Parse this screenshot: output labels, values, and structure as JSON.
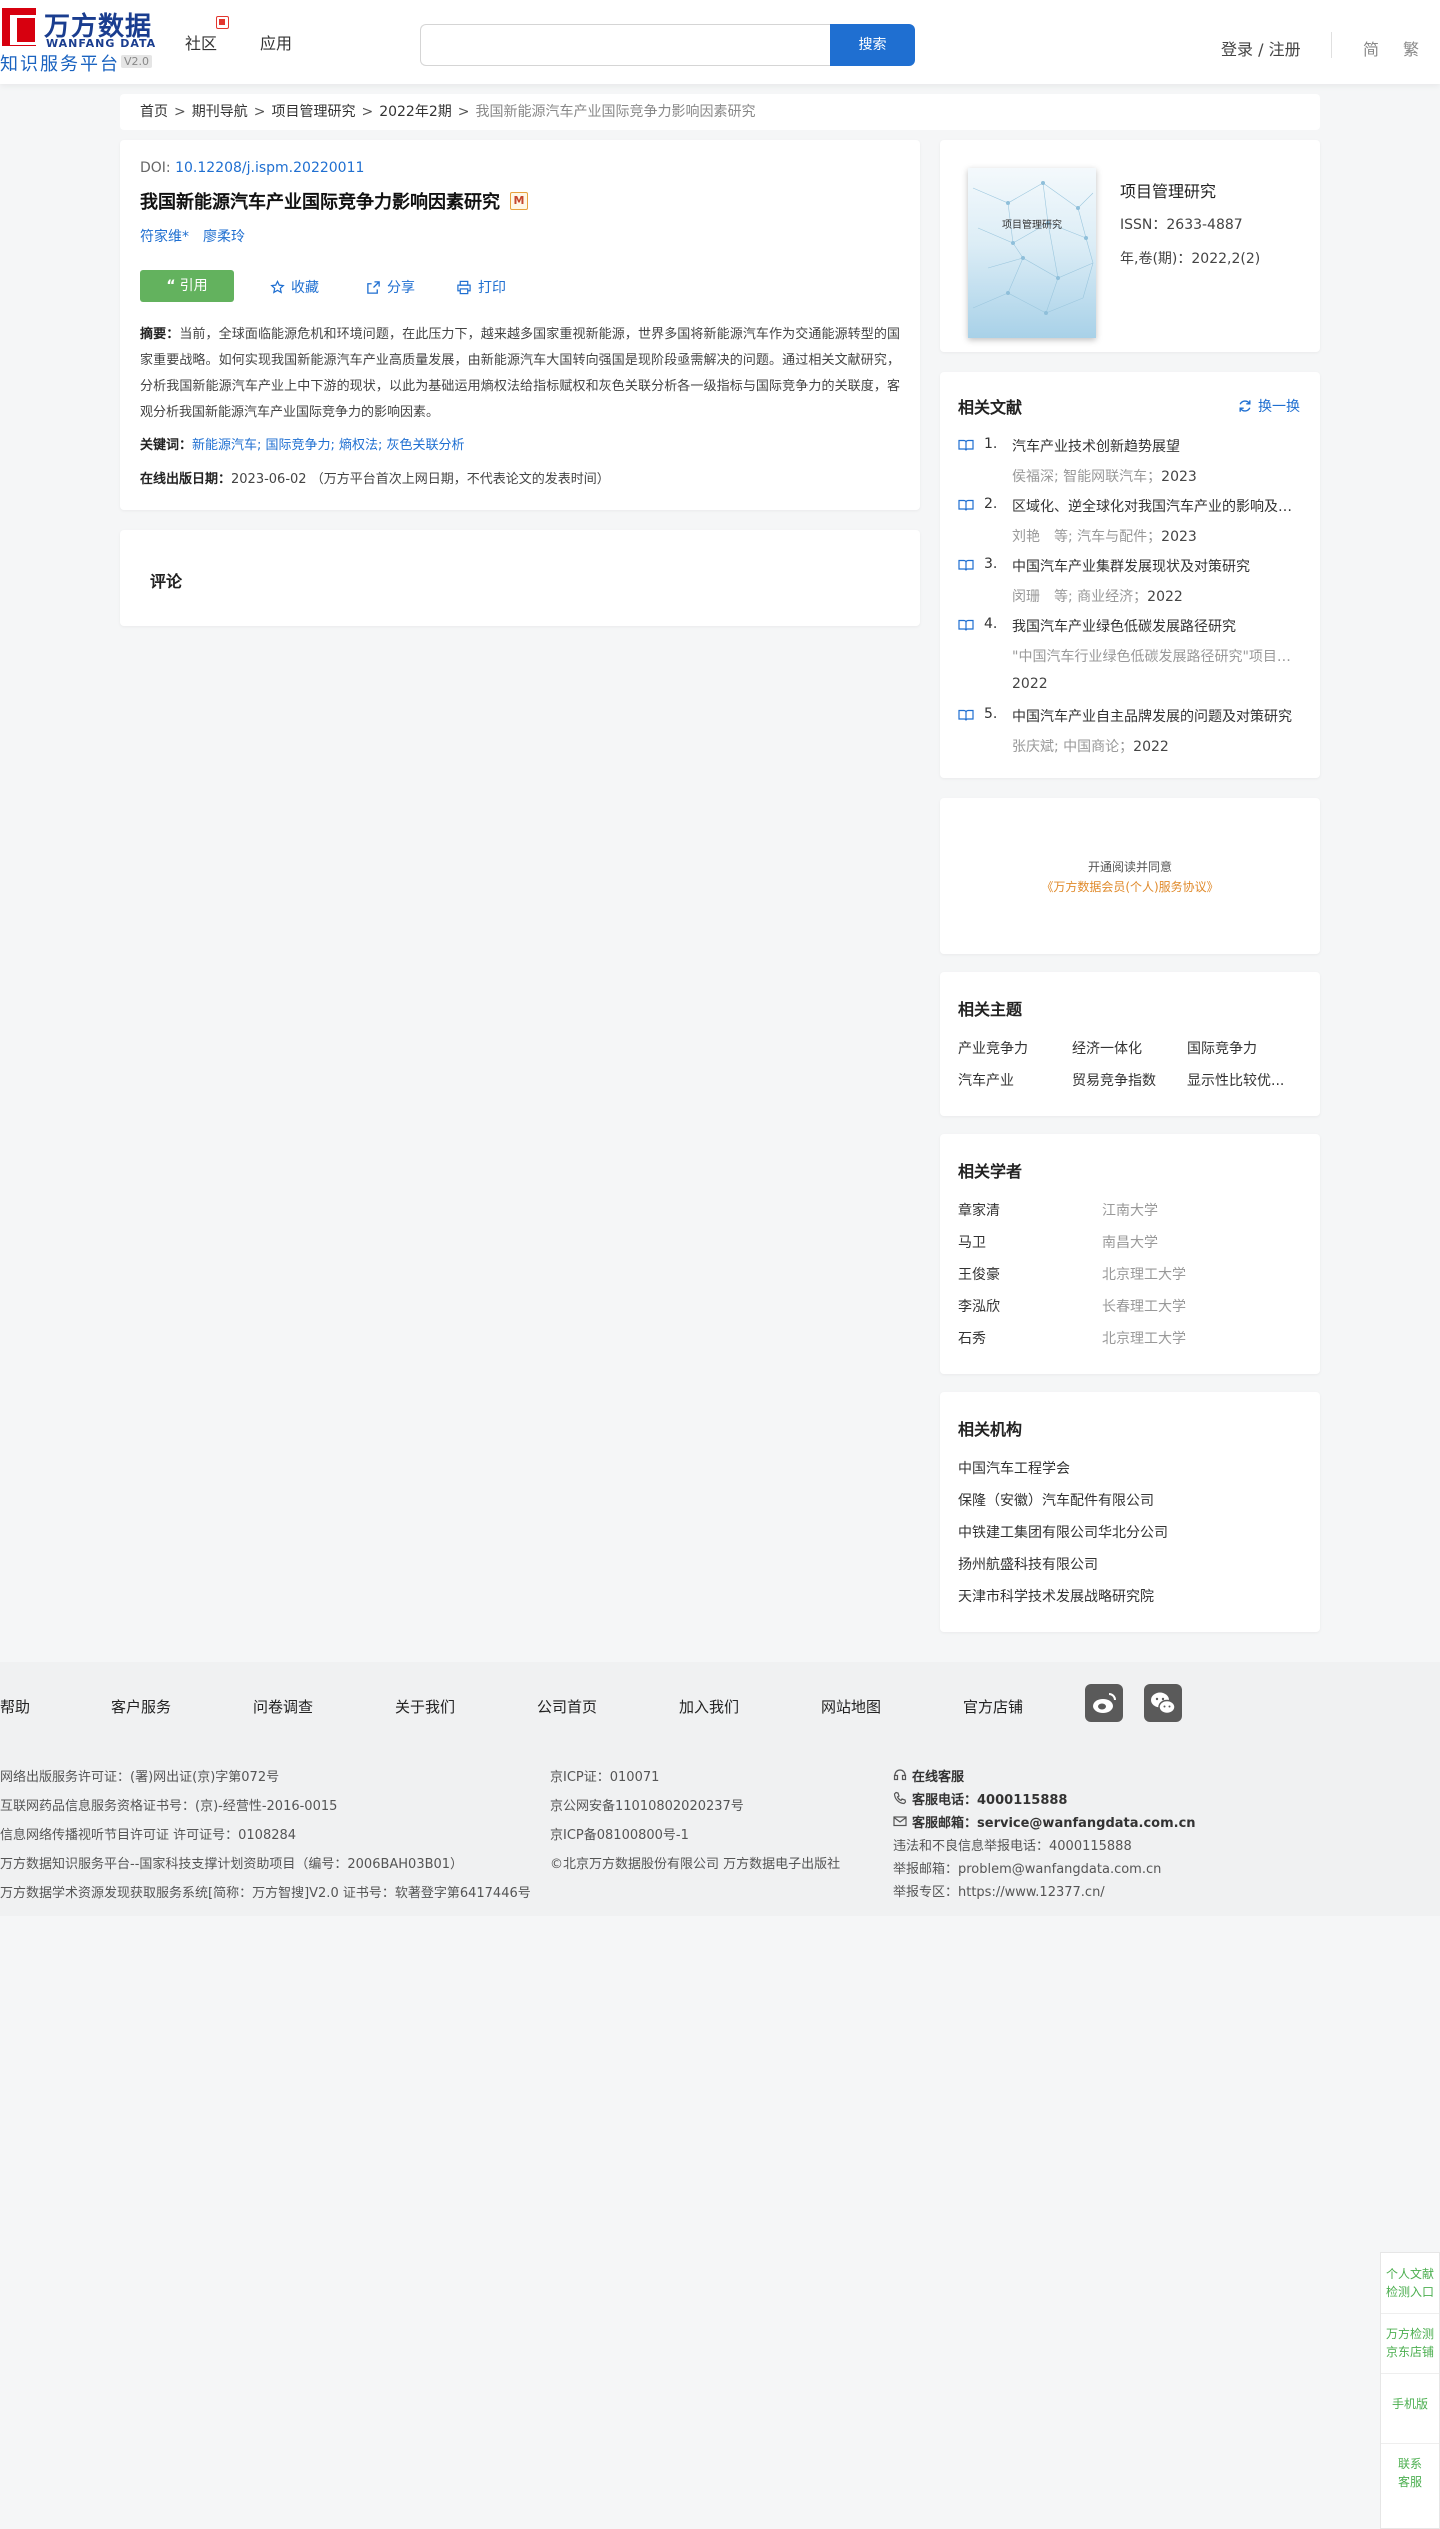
{
  "header": {
    "logo_cn": "万方数据",
    "logo_en": "WANFANG DATA",
    "platform": "知识服务平台",
    "version": "V2.0",
    "nav": [
      "社区",
      "应用"
    ],
    "search_placeholder": "",
    "search_button": "搜索",
    "login": "登录 / 注册",
    "lang_simplified": "简",
    "lang_traditional": "繁"
  },
  "breadcrumb": [
    "首页",
    "期刊导航",
    "项目管理研究",
    "2022年2期",
    "我国新能源汽车产业国际竞争力影响因素研究"
  ],
  "article": {
    "doi_label": "DOI: ",
    "doi": "10.12208/j.ispm.20220011",
    "title": "我国新能源汽车产业国际竞争力影响因素研究",
    "m_badge": "M",
    "authors": [
      "符家维*",
      "廖柔玲"
    ],
    "cite": "引用",
    "favorite": "收藏",
    "share": "分享",
    "print": "打印",
    "abstract_label": "摘要：",
    "abstract": "当前，全球面临能源危机和环境问题，在此压力下，越来越多国家重视新能源，世界多国将新能源汽车作为交通能源转型的国家重要战略。如何实现我国新能源汽车产业高质量发展，由新能源汽车大国转向强国是现阶段亟需解决的问题。通过相关文献研究，分析我国新能源汽车产业上中下游的现状，以此为基础运用熵权法给指标赋权和灰色关联分析各一级指标与国际竞争力的关联度，客观分析我国新能源汽车产业国际竞争力的影响因素。",
    "keywords_label": "关键词：",
    "keywords": "新能源汽车; 国际竞争力; 熵权法; 灰色关联分析",
    "pubdate_label": "在线出版日期：",
    "pubdate": "2023-06-02  （万方平台首次上网日期，不代表论文的发表时间）"
  },
  "comment": {
    "title": "评论"
  },
  "journal": {
    "cover_title": "项目管理研究",
    "name": "项目管理研究",
    "issn": "ISSN：2633-4887",
    "volume": "年,卷(期)：2022,2(2)"
  },
  "related_docs": {
    "title": "相关文献",
    "swap": "换一换",
    "items": [
      {
        "num": "1.",
        "title": "汽车产业技术创新趋势展望",
        "source": "侯福深; 智能网联汽车；",
        "year": "2023"
      },
      {
        "num": "2.",
        "title": "区域化、逆全球化对我国汽车产业的影响及对策研究",
        "source": "刘艳　等;  汽车与配件；",
        "year": "2023"
      },
      {
        "num": "3.",
        "title": "中国汽车产业集群发展现状及对策研究",
        "source": "闵珊　等;  商业经济；",
        "year": "2022"
      },
      {
        "num": "4.",
        "title": "我国汽车产业绿色低碳发展路径研究",
        "source": "\"中国汽车行业绿色低碳发展路径研究\"项目组；中国汽车；",
        "year": "2022"
      },
      {
        "num": "5.",
        "title": "中国汽车产业自主品牌发展的问题及对策研究",
        "source": "张庆斌; 中国商论；",
        "year": "2022"
      }
    ]
  },
  "ad": {
    "line1": "开通阅读并同意",
    "line2": "《万方数据会员(个人)服务协议》"
  },
  "topics": {
    "title": "相关主题",
    "items": [
      "产业竞争力",
      "经济一体化",
      "国际竞争力",
      "汽车产业",
      "贸易竞争指数",
      "显示性比较优..."
    ]
  },
  "scholars": {
    "title": "相关学者",
    "items": [
      {
        "name": "章家清",
        "org": "江南大学"
      },
      {
        "name": "马卫",
        "org": "南昌大学"
      },
      {
        "name": "王俊豪",
        "org": "北京理工大学"
      },
      {
        "name": "李泓欣",
        "org": "长春理工大学"
      },
      {
        "name": "石秀",
        "org": "北京理工大学"
      }
    ]
  },
  "orgs": {
    "title": "相关机构",
    "items": [
      "中国汽车工程学会",
      "保隆（安徽）汽车配件有限公司",
      "中铁建工集团有限公司华北分公司",
      "扬州航盛科技有限公司",
      "天津市科学技术发展战略研究院"
    ]
  },
  "footer": {
    "links": [
      "帮助",
      "客户服务",
      "问卷调查",
      "关于我们",
      "公司首页",
      "加入我们",
      "网站地图",
      "官方店铺"
    ],
    "col1": [
      "网络出版服务许可证：(署)网出证(京)字第072号",
      "互联网药品信息服务资格证书号：(京)-经营性-2016-0015",
      "信息网络传播视听节目许可证 许可证号：0108284",
      "万方数据知识服务平台--国家科技支撑计划资助项目（编号：2006BAH03B01）",
      "万方数据学术资源发现获取服务系统[简称：万方智搜]V2.0 证书号：软著登字第6417446号"
    ],
    "col2": [
      "京ICP证：010071",
      "京公网安备11010802020237号",
      "京ICP备08100800号-1",
      "©北京万方数据股份有限公司 万方数据电子出版社"
    ],
    "online_service": "在线客服",
    "phone_label": "客服电话：",
    "phone": "4000115888",
    "email_label": "客服邮箱：",
    "email": "service@wanfangdata.com.cn",
    "report_phone": "违法和不良信息举报电话：4000115888",
    "report_email": "举报邮箱：problem@wanfangdata.com.cn",
    "report_zone": "举报专区：https://www.12377.cn/"
  },
  "side_float": {
    "item1": [
      "个人文献",
      "检测入口"
    ],
    "item2": [
      "万方检测",
      "京东店铺"
    ],
    "item3": "手机版",
    "item4": [
      "联系",
      "客服"
    ]
  },
  "colors": {
    "primary": "#1f6fd1",
    "cite_green": "#63b25e",
    "brand_red": "#d7000f",
    "ad_orange": "#e08a2b",
    "side_green": "#4caf50"
  }
}
